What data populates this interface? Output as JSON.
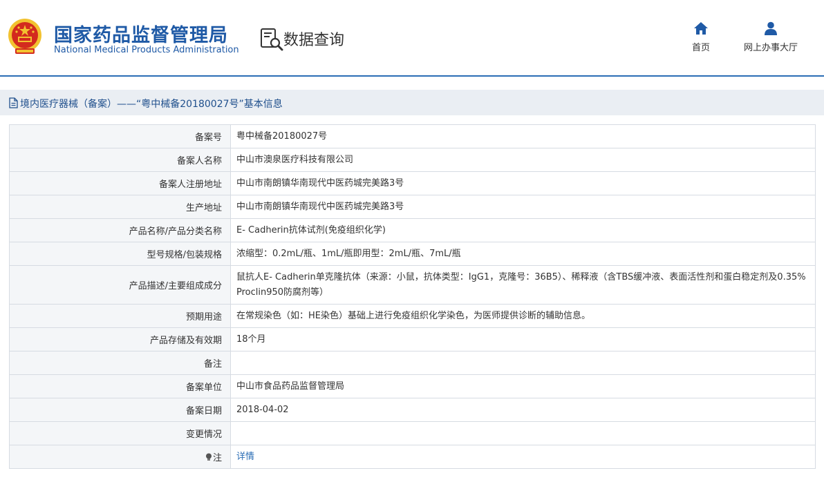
{
  "header": {
    "brand_cn": "国家药品监督管理局",
    "brand_en": "National Medical Products Administration",
    "query_title": "数据查询",
    "nav": [
      {
        "label": "首页",
        "icon": "home-icon"
      },
      {
        "label": "网上办事大厅",
        "icon": "user-icon"
      }
    ]
  },
  "titlebar": {
    "text": "境内医疗器械（备案）——“粤中械备20180027号”基本信息",
    "icon": "document-icon"
  },
  "rows": [
    {
      "key": "备案号",
      "value": "粤中械备20180027号"
    },
    {
      "key": "备案人名称",
      "value": "中山市澳泉医疗科技有限公司"
    },
    {
      "key": "备案人注册地址",
      "value": "中山市南朗镇华南现代中医药城完美路3号"
    },
    {
      "key": "生产地址",
      "value": "中山市南朗镇华南现代中医药城完美路3号"
    },
    {
      "key": "产品名称/产品分类名称",
      "value": "E- Cadherin抗体试剂(免疫组织化学)"
    },
    {
      "key": "型号规格/包装规格",
      "value": "浓缩型：0.2mL/瓶、1mL/瓶即用型：2mL/瓶、7mL/瓶"
    },
    {
      "key": "产品描述/主要组成成分",
      "value": "鼠抗人E- Cadherin单克隆抗体（来源：小鼠，抗体类型：IgG1，克隆号：36B5）、稀释液（含TBS缓冲液、表面活性剂和蛋白稳定剂及0.35% Proclin950防腐剂等）"
    },
    {
      "key": "预期用途",
      "value": "在常规染色（如：HE染色）基础上进行免疫组织化学染色，为医师提供诊断的辅助信息。"
    },
    {
      "key": "产品存储及有效期",
      "value": "18个月"
    },
    {
      "key": "备注",
      "value": ""
    },
    {
      "key": "备案单位",
      "value": "中山市食品药品监督管理局"
    },
    {
      "key": "备案日期",
      "value": "2018-04-02"
    },
    {
      "key": "变更情况",
      "value": ""
    },
    {
      "key": "注",
      "value": "详情",
      "icon": "lightbulb-icon"
    }
  ],
  "colors": {
    "brand_blue": "#1f5aa6",
    "link_blue": "#2a6db5",
    "titlebar_bg": "#eaeef3",
    "emblem_red": "#d32a1e",
    "emblem_gold": "#f2c230"
  }
}
